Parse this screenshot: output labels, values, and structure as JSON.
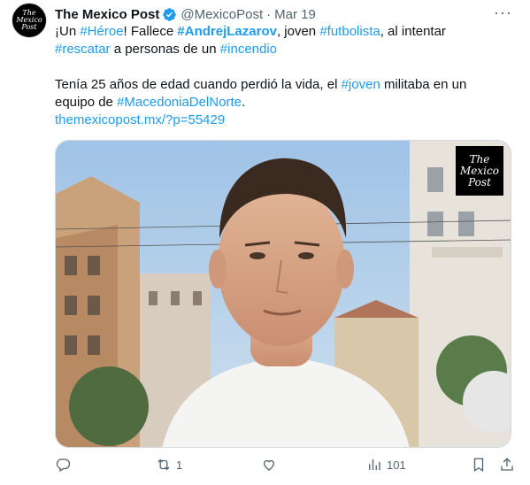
{
  "author": {
    "name": "The Mexico Post",
    "handle": "@MexicoPost",
    "dot": "·",
    "time": "Mar 19",
    "avatar_text": "The Mexico Post"
  },
  "text": {
    "l1_a": "¡Un ",
    "l1_tag1": "#Héroe",
    "l1_b": "! Fallece ",
    "l1_tag2": "#AndrejLazarov",
    "l1_c": ", joven ",
    "l1_tag3": "#futbolista",
    "l1_d": ", al intentar",
    "l2_tag1": "#rescatar",
    "l2_a": " a personas de un ",
    "l2_tag2": "#incendio",
    "l3_a": "Tenía 25 años de edad cuando perdió la vida, el ",
    "l3_tag": "#joven",
    "l3_b": " militaba en un",
    "l4_a": "equipo de ",
    "l4_tag": "#MacedoniaDelNorte",
    "l4_b": ".",
    "link": "themexicopost.mx/?p=55429"
  },
  "media": {
    "logo_text": "The Mexico Post"
  },
  "actions": {
    "replies": "",
    "reposts": "1",
    "likes": "",
    "views": "101"
  },
  "colors": {
    "accent": "#1d9bf0",
    "secondary_text": "#536471"
  }
}
